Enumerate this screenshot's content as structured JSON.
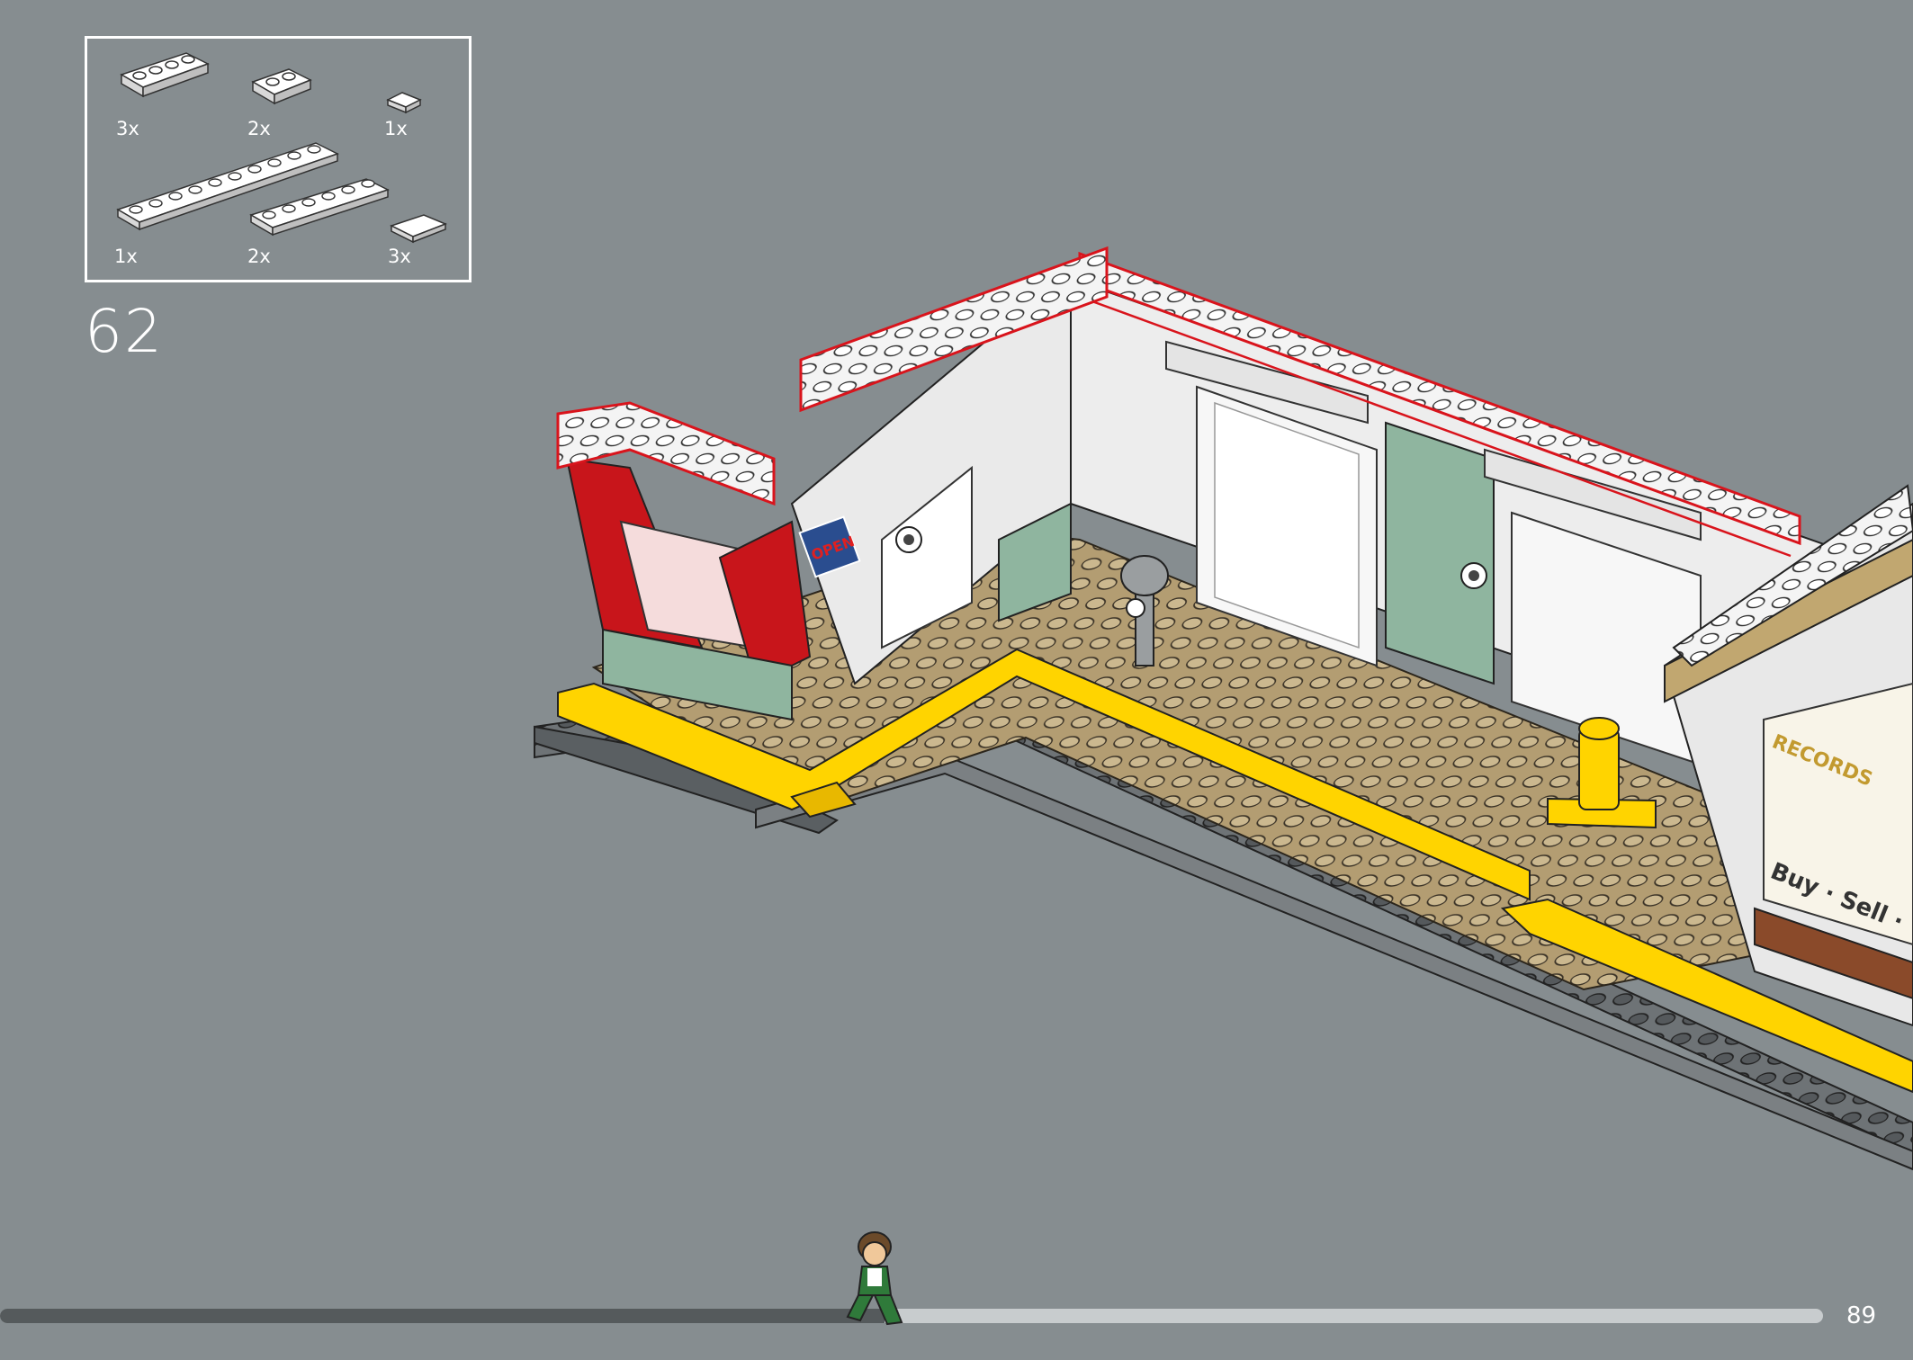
{
  "parts_list": {
    "items": [
      {
        "qty": "3x",
        "part": "white-bracket-1x4"
      },
      {
        "qty": "2x",
        "part": "white-bracket-1x2"
      },
      {
        "qty": "1x",
        "part": "white-tile-1x1"
      },
      {
        "qty": "1x",
        "part": "white-plate-1x10"
      },
      {
        "qty": "2x",
        "part": "white-plate-1x6"
      },
      {
        "qty": "3x",
        "part": "white-tile-1x2"
      }
    ]
  },
  "step": {
    "number": "62"
  },
  "scene": {
    "signs": {
      "open": "OPEN",
      "buy_sell_trade": "Buy · Sell · Trade",
      "record_store": "RECORDS"
    }
  },
  "progress": {
    "fraction": 0.485
  },
  "page": {
    "number": "89"
  },
  "colors": {
    "background": "#868d90",
    "highlight": "#d9141c",
    "wall_white": "#f2f2f2",
    "red": "#c8151b",
    "sand_green": "#8fb59f",
    "tan": "#b8a37a",
    "yellow": "#ffd400",
    "dark_grey": "#5f6467"
  }
}
